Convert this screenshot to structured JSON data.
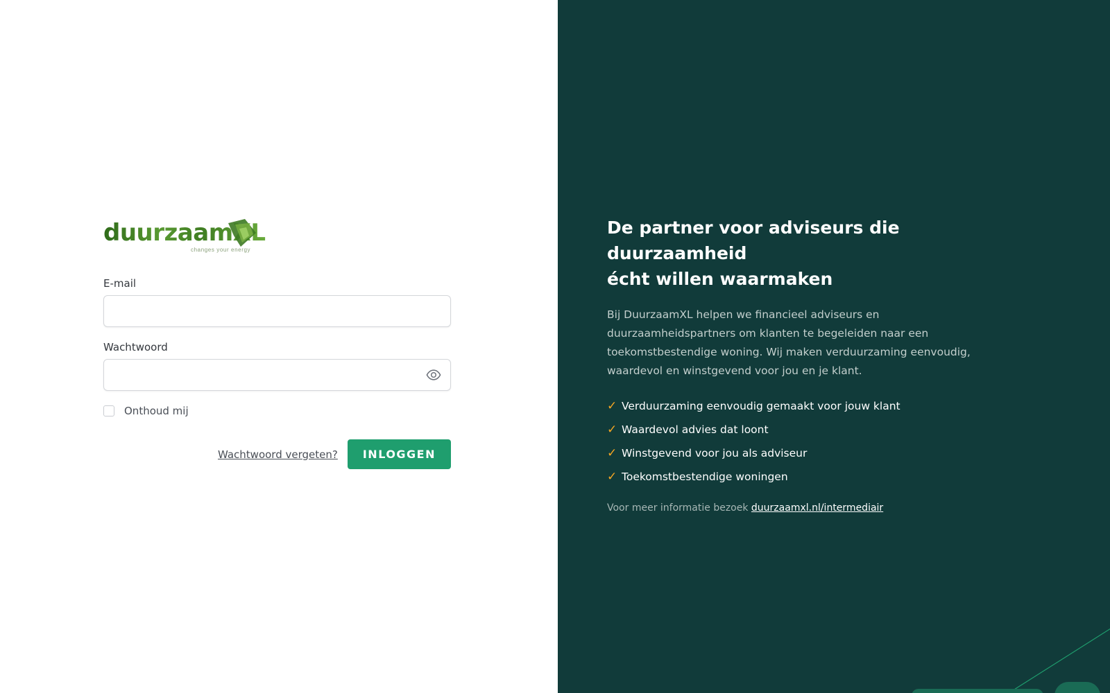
{
  "brand": {
    "logo_text": "duurzaamXL",
    "tagline": "changes your energy"
  },
  "login_form": {
    "email_label": "E-mail",
    "email_value": "",
    "password_label": "Wachtwoord",
    "password_value": "",
    "remember_label": "Onthoud mij",
    "remember_checked": false,
    "forgot_link": "Wachtwoord vergeten?",
    "submit_label": "INLOGGEN"
  },
  "promo": {
    "headline_line1": "De partner voor adviseurs die duurzaamheid",
    "headline_line2": "écht willen waarmaken",
    "intro": "Bij DuurzaamXL helpen we financieel adviseurs en duurzaamheidspartners om klanten te begeleiden naar een toekomstbestendige woning. Wij maken verduurzaming eenvoudig, waardevol en winstgevend voor jou en je klant.",
    "bullets": [
      "Verduurzaming eenvoudig gemaakt voor jouw klant",
      "Waardevol advies dat loont",
      "Winstgevend voor jou als adviseur",
      "Toekomstbestendige woningen"
    ],
    "check_glyph": "✓",
    "more_info_prefix": "Voor meer informatie bezoek ",
    "more_info_link": "duurzaamxl.nl/intermediair"
  },
  "colors": {
    "right_panel_bg": "#113b3a",
    "primary_button": "#1f9e6e",
    "check_accent": "#f5a623",
    "logo_green": "#4e8a2b"
  },
  "icons": {
    "password_toggle": "eye-icon",
    "bullet": "check-icon"
  }
}
